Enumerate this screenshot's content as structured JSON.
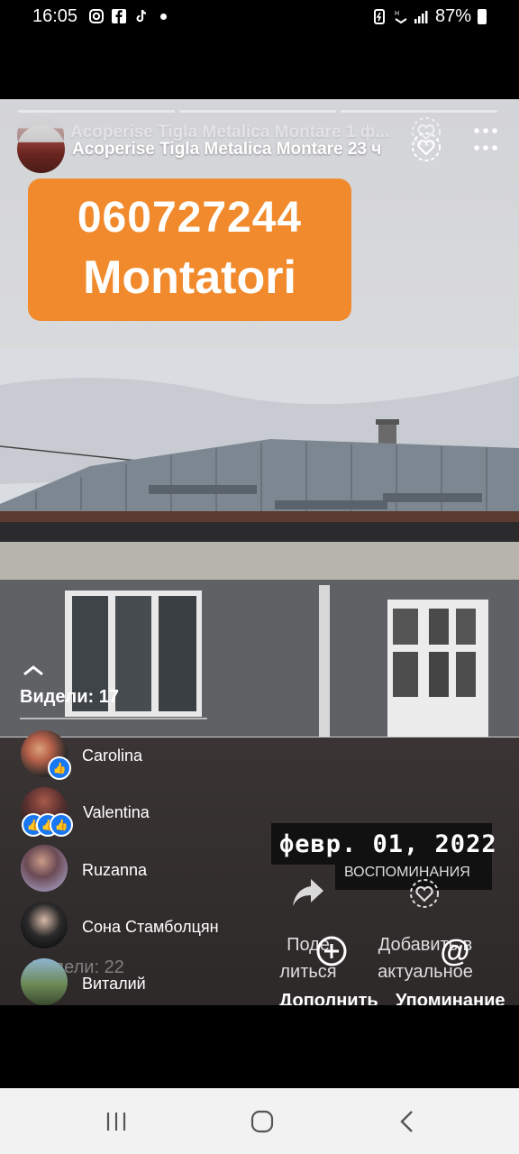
{
  "status_bar": {
    "time": "16:05",
    "battery": "87%",
    "icons": [
      "instagram-icon",
      "facebook-icon",
      "tiktok-icon",
      "dot-icon",
      "battery-saver-icon",
      "wifi-icon",
      "signal-icon",
      "battery-icon"
    ]
  },
  "story": {
    "progress_segments": 3,
    "title_behind": "Acoperise Tigla Metalica Montare 1 ф...",
    "title": "Acoperise Tigla Metalica Montare 23 ч",
    "banner_phone": "060727244",
    "banner_sub": "Montatori"
  },
  "viewers": {
    "label": "Видели: 17",
    "ghost_label": "Видели: 22",
    "list": [
      {
        "name": "Carolina"
      },
      {
        "name": "Valentina"
      },
      {
        "name": "Ruzanna"
      },
      {
        "name": "Сона Стамболцян"
      },
      {
        "name": "Виталий"
      }
    ]
  },
  "overlay": {
    "date": "февр. 01, 2022",
    "memories": "ВОСПОМИНАНИЯ",
    "share_label_1": "Поде",
    "share_label_2": "литься",
    "add_label_1": "Добавить в",
    "add_label_2": "актуальное",
    "more_label": "Дополнить",
    "mention_label": "Упоминание"
  },
  "colors": {
    "banner": "#f18a2c",
    "like_blue": "#1877f2"
  }
}
